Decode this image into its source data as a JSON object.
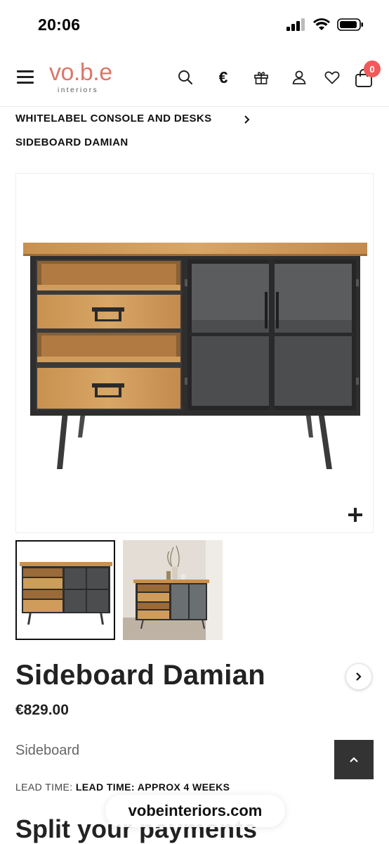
{
  "status_bar": {
    "time": "20:06"
  },
  "header": {
    "logo_text": "vo.b.e",
    "logo_subtext": "interiors",
    "currency_symbol": "€",
    "cart_count": "0"
  },
  "breadcrumb": [
    {
      "label": "WHITELABEL CONSOLE AND DESKS"
    },
    {
      "label": "SIDEBOARD DAMIAN"
    }
  ],
  "product": {
    "title": "Sideboard Damian",
    "price": "€829.00",
    "category": "Sideboard",
    "lead_time_label": "LEAD TIME:",
    "lead_time_value": "LEAD TIME: APPROX 4 WEEKS",
    "split_heading": "Split your payments"
  },
  "browser": {
    "url": "vobeinteriors.com"
  },
  "colors": {
    "brand": "#d9786a",
    "badge": "#f05a5a",
    "wood": "#c48a4e",
    "metal": "#3a3a3a"
  }
}
